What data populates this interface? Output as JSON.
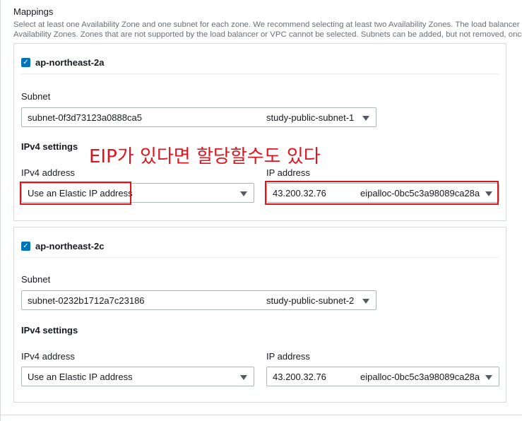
{
  "section": {
    "title": "Mappings",
    "description_line1": "Select at least one Availability Zone and one subnet for each zone. We recommend selecting at least two Availability Zones. The load balancer will r",
    "description_line2": "Availability Zones. Zones that are not supported by the load balancer or VPC cannot be selected. Subnets can be added, but not removed, once a lo"
  },
  "annotation": "EIP가 있다면 할당할수도 있다",
  "zones": [
    {
      "name": "ap-northeast-2a",
      "checked": true,
      "subnet_label": "Subnet",
      "subnet_id": "subnet-0f3d73123a0888ca5",
      "subnet_name": "study-public-subnet-1",
      "ipv4_settings_label": "IPv4 settings",
      "ipv4_address_label": "IPv4 address",
      "ipv4_address_value": "Use an Elastic IP address",
      "ip_address_label": "IP address",
      "ip_address_value": "43.200.32.76",
      "eip_alloc": "eipalloc-0bc5c3a98089ca28a"
    },
    {
      "name": "ap-northeast-2c",
      "checked": true,
      "subnet_label": "Subnet",
      "subnet_id": "subnet-0232b1712a7c23186",
      "subnet_name": "study-public-subnet-2",
      "ipv4_settings_label": "IPv4 settings",
      "ipv4_address_label": "IPv4 address",
      "ipv4_address_value": "Use an Elastic IP address",
      "ip_address_label": "IP address",
      "ip_address_value": "43.200.32.76",
      "eip_alloc": "eipalloc-0bc5c3a98089ca28a"
    }
  ],
  "colors": {
    "accent": "#0073bb",
    "annotation": "#e0141e",
    "border": "#aab7b8"
  }
}
